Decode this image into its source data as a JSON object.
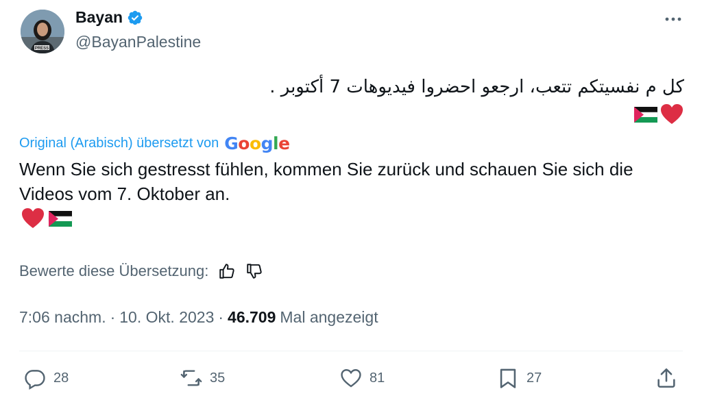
{
  "author": {
    "name": "Bayan",
    "handle": "@BayanPalestine",
    "avatar_badge": "PRESS"
  },
  "tweet": {
    "original_text": "كل م نفسيتكم تتعب، ارجعو احضروا فيديوهات 7 أكتوبر .",
    "translation_label": "Original (Arabisch) übersetzt von",
    "translation_provider": "Google",
    "translated_text": "Wenn Sie sich gestresst fühlen, kommen Sie zurück und schauen Sie sich die Videos vom 7. Oktober an.",
    "emojis": [
      "red-heart-icon",
      "palestine-flag-icon"
    ]
  },
  "rating": {
    "label": "Bewerte diese Übersetzung:"
  },
  "meta": {
    "time": "7:06 nachm.",
    "separator": "·",
    "date": "10. Okt. 2023",
    "views_count": "46.709",
    "views_label": "Mal angezeigt"
  },
  "actions": {
    "replies": "28",
    "reposts": "35",
    "likes": "81",
    "bookmarks": "27"
  },
  "colors": {
    "accent": "#1d9bf0",
    "text": "#0f1419",
    "secondary": "#536471",
    "heart": "#e0245e"
  }
}
